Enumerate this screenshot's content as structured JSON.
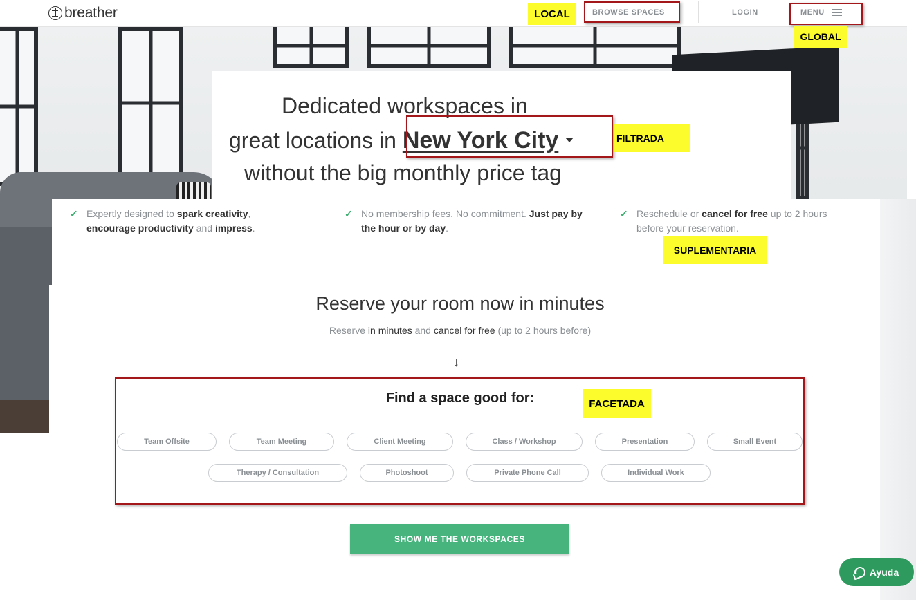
{
  "header": {
    "logo_text": "breather",
    "browse_label": "BROWSE SPACES",
    "login_label": "LOGIN",
    "menu_label": "MENU"
  },
  "annotations": {
    "local": "LOCAL",
    "global": "GLOBAL",
    "filtrada": "FILTRADA",
    "suplementaria": "SUPLEMENTARIA",
    "facetada": "FACETADA"
  },
  "hero": {
    "line1": "Dedicated workspaces in",
    "line2_prefix": "great locations in",
    "city": "New York City",
    "line3": "without the big monthly price tag"
  },
  "benefits": [
    {
      "t1": "Expertly designed to ",
      "b1": "spark creativity",
      "t2": ",",
      "b2": "encourage productivity",
      "t3": " and ",
      "b3": "impress",
      "t4": "."
    },
    {
      "t1": "No membership fees. No commitment. ",
      "b1": "Just pay by the hour or by day",
      "t2": "."
    },
    {
      "t1": "Reschedule or ",
      "b1": "cancel for free",
      "t2": " up to 2 hours before your reservation."
    }
  ],
  "reserve": {
    "title": "Reserve your room now in minutes",
    "sub_1": "Reserve ",
    "sub_2": "in minutes",
    "sub_3": " and ",
    "sub_4": "cancel for free",
    "sub_5": " (up to 2 hours before)"
  },
  "find": {
    "title": "Find a space good for:",
    "options_row1": [
      "Team Offsite",
      "Team Meeting",
      "Client Meeting",
      "Class / Workshop",
      "Presentation",
      "Small Event"
    ],
    "options_row2": [
      "Therapy / Consultation",
      "Photoshoot",
      "Private Phone Call",
      "Individual Work"
    ]
  },
  "cta_label": "SHOW ME THE WORKSPACES",
  "help_label": "Ayuda",
  "colors": {
    "accent_green": "#48b47d",
    "help_green": "#2e9a5e",
    "annotation_yellow": "#fcfc2c",
    "annotation_red": "#a3161a"
  }
}
